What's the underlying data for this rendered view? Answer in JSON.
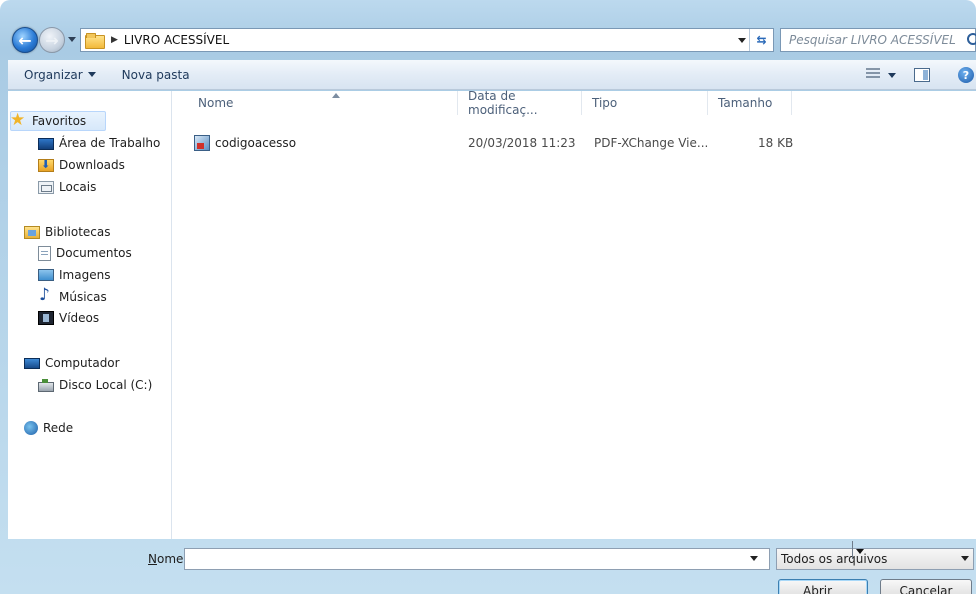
{
  "address": {
    "path": [
      "LIVRO ACESSÍVEL"
    ],
    "search_placeholder": "Pesquisar LIVRO ACESSÍVEL"
  },
  "toolbar": {
    "organize_label": "Organizar",
    "new_folder_label": "Nova pasta"
  },
  "navigation": {
    "favorites": {
      "label": "Favoritos",
      "items": [
        "Área de Trabalho",
        "Downloads",
        "Locais"
      ]
    },
    "libraries": {
      "label": "Bibliotecas",
      "items": [
        "Documentos",
        "Imagens",
        "Músicas",
        "Vídeos"
      ]
    },
    "computer": {
      "label": "Computador",
      "items": [
        "Disco Local (C:)"
      ]
    },
    "network": {
      "label": "Rede"
    }
  },
  "file_list": {
    "columns": [
      "Nome",
      "Data de modificaç...",
      "Tipo",
      "Tamanho"
    ],
    "rows": [
      {
        "name": "codigoacesso",
        "date": "20/03/2018 11:23",
        "type": "PDF-XChange Vie...",
        "size": "18 KB"
      }
    ]
  },
  "bottom": {
    "name_label_prefix": "",
    "name_label_underlined": "N",
    "name_label_rest": "ome:",
    "name_value": "",
    "file_type_selected": "Todos os arquivos",
    "open_underlined": "A",
    "open_rest": "brir",
    "cancel_label": "Cancelar"
  },
  "colors": {
    "frame": "#bcd9ee",
    "toolbar": "#e3ecf6",
    "selection": "#d7e8fa",
    "header_text": "#4c607a"
  },
  "icons": {
    "back": "back-arrow-icon",
    "forward": "forward-arrow-icon",
    "refresh": "refresh-icon",
    "search": "search-icon",
    "help": "help-icon"
  }
}
